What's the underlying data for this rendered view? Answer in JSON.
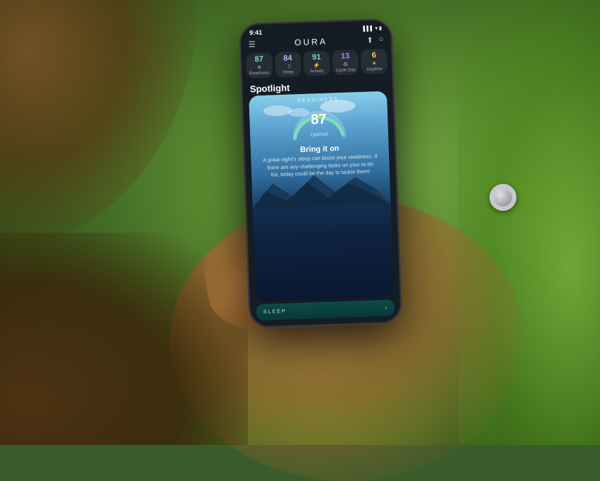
{
  "scene": {
    "bg_colors": {
      "foliage_dark": "#2a4a18",
      "foliage_mid": "#5a8a30",
      "foliage_light": "#8abc48",
      "skin_tone": "#c87840"
    }
  },
  "phone": {
    "status_bar": {
      "time": "9:41",
      "signal": "▌▌▌",
      "wifi": "wifi",
      "battery": "battery"
    },
    "app": {
      "name": "OURA",
      "menu_icon": "☰",
      "share_icon": "⬆",
      "profile_icon": "○"
    },
    "scores": [
      {
        "number": "87",
        "icon": "☀",
        "label": "Readiness",
        "color": "#7adfbe"
      },
      {
        "number": "84",
        "icon": "🌙",
        "label": "Sleep",
        "color": "#7adfbe"
      },
      {
        "number": "91",
        "icon": "⚡",
        "label": "Activity",
        "color": "#7adfbe"
      },
      {
        "number": "13",
        "icon": "♻",
        "label": "Cycle Day",
        "color": "#b088e8"
      },
      {
        "number": "6",
        "icon": "☀",
        "label": "Daytime",
        "color": "#7adfbe"
      }
    ],
    "spotlight": {
      "heading": "Spotlight",
      "readiness_card": {
        "section_label": "READINESS",
        "score": "87",
        "score_sublabel": "Optimal",
        "crown_icon": "♛",
        "title": "Bring it on",
        "description": "A great night's sleep can boost your readiness. If there are any challenging tasks on your to-do list, today could be the day to tackle them!"
      },
      "sleep_section": {
        "label": "SLEEP",
        "arrow": "›"
      }
    }
  }
}
